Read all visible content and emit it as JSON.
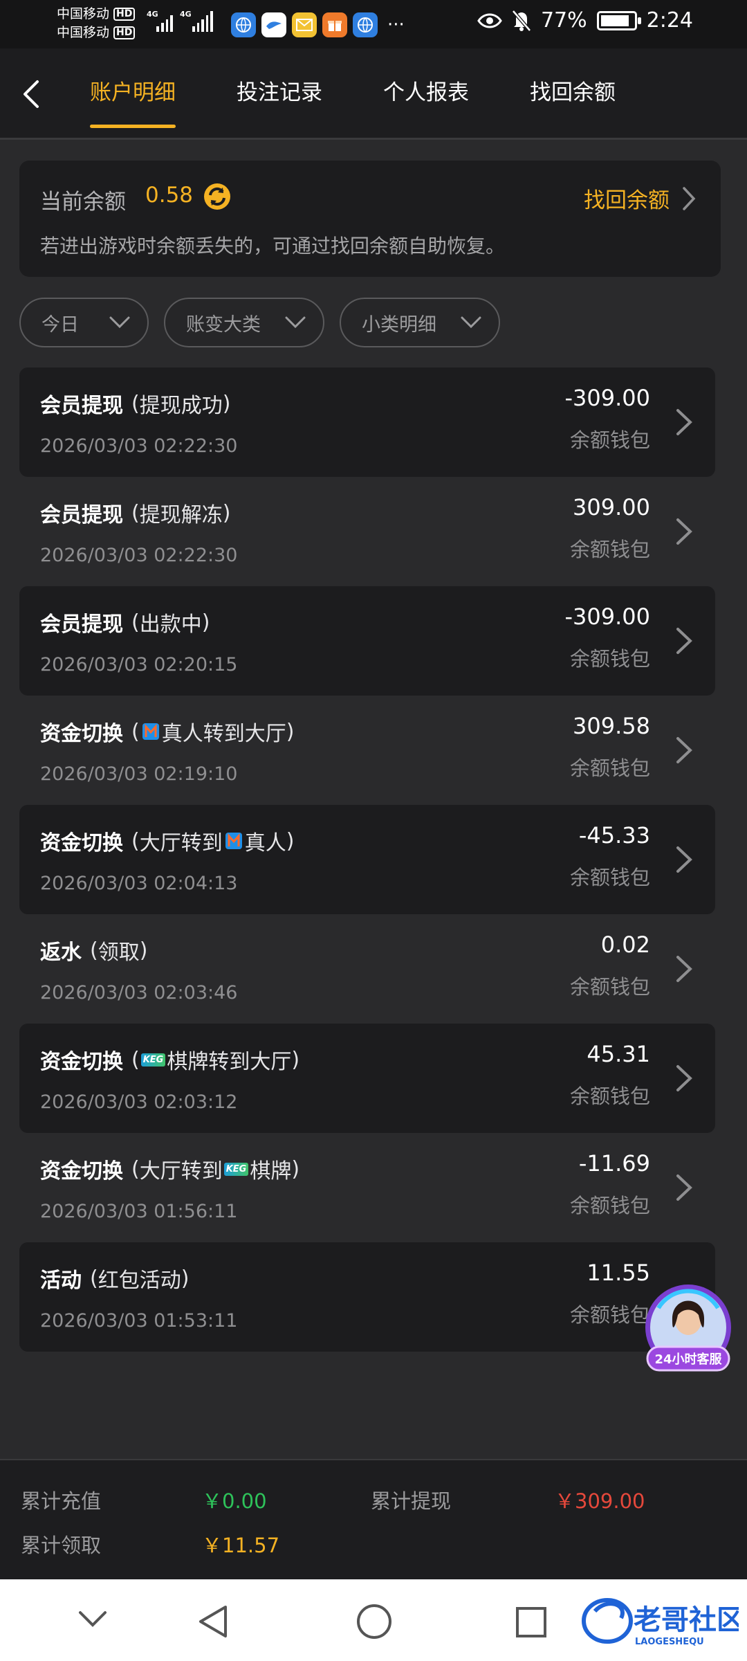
{
  "statusbar": {
    "carrier1": "中国移动",
    "carrier2": "中国移动",
    "hd": "HD",
    "net1": "4G",
    "net2": "4G",
    "battery": "77%",
    "time": "2:24"
  },
  "header": {
    "tabs": [
      {
        "label": "账户明细",
        "active": true
      },
      {
        "label": "投注记录",
        "active": false
      },
      {
        "label": "个人报表",
        "active": false
      },
      {
        "label": "找回余额",
        "active": false
      }
    ]
  },
  "balance": {
    "label": "当前余额",
    "value": "0.58",
    "recover_label": "找回余额",
    "note": "若进出游戏时余额丢失的，可通过找回余额自助恢复。"
  },
  "filters": {
    "date": "今日",
    "category": "账变大类",
    "subcategory": "小类明细"
  },
  "records": [
    {
      "main": "会员提现",
      "open": "(",
      "detail_a": "提现成功",
      "close": ")",
      "time": "2026/03/03 02:22:30",
      "amount": "-309.00",
      "wallet": "余额钱包"
    },
    {
      "main": "会员提现",
      "open": "(",
      "detail_a": "提现解冻",
      "close": ")",
      "time": "2026/03/03 02:22:30",
      "amount": "309.00",
      "wallet": "余额钱包"
    },
    {
      "main": "会员提现",
      "open": "(",
      "detail_a": "出款中",
      "close": ")",
      "time": "2026/03/03 02:20:15",
      "amount": "-309.00",
      "wallet": "余额钱包"
    },
    {
      "main": "资金切换",
      "open": "(",
      "detail_a": "真人转到大厅",
      "close": ")",
      "time": "2026/03/03 02:19:10",
      "amount": "309.58",
      "wallet": "余额钱包"
    },
    {
      "main": "资金切换",
      "open": "(",
      "detail_a": "大厅转到",
      "detail_b": "真人",
      "close": ")",
      "time": "2026/03/03 02:04:13",
      "amount": "-45.33",
      "wallet": "余额钱包"
    },
    {
      "main": "返水",
      "open": "(",
      "detail_a": "领取",
      "close": ")",
      "time": "2026/03/03 02:03:46",
      "amount": "0.02",
      "wallet": "余额钱包"
    },
    {
      "main": "资金切换",
      "open": "(",
      "detail_a": "棋牌转到大厅",
      "close": ")",
      "time": "2026/03/03 02:03:12",
      "amount": "45.31",
      "wallet": "余额钱包"
    },
    {
      "main": "资金切换",
      "open": "(",
      "detail_a": "大厅转到",
      "detail_b": "棋牌",
      "close": ")",
      "time": "2026/03/03 01:56:11",
      "amount": "-11.69",
      "wallet": "余额钱包"
    },
    {
      "main": "活动",
      "open": "(",
      "detail_a": "红包活动",
      "close": ")",
      "time": "2026/03/03 01:53:11",
      "amount": "11.55",
      "wallet": "余额钱包"
    }
  ],
  "service": {
    "label": "24小时客服"
  },
  "summary": {
    "recharge_label": "累计充值",
    "recharge_value": "￥0.00",
    "withdraw_label": "累计提现",
    "withdraw_value": "￥309.00",
    "claim_label": "累计领取",
    "claim_value": "￥11.57"
  },
  "colors": {
    "accent": "#f5b223",
    "green": "#2ec25a",
    "red": "#e5483b",
    "background": "#2a2a2c",
    "card": "#1c1c1e"
  },
  "icons": {
    "live_game": "m-logo-icon",
    "chess_game": "keg-logo-icon"
  },
  "watermark": {
    "text": "老哥社区",
    "sub": "LAOGESHEQU"
  }
}
